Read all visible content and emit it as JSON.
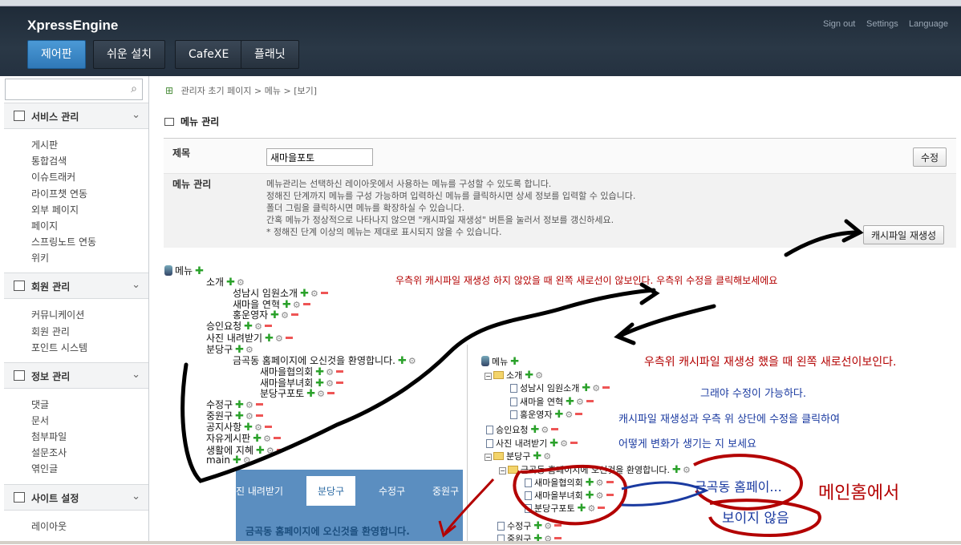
{
  "header": {
    "brand": "XpressEngine",
    "nav": [
      "제어판",
      "쉬운 설치",
      "CafeXE",
      "플래닛"
    ],
    "util": [
      "Sign out",
      "Settings",
      "Language"
    ]
  },
  "sidebar": {
    "sections": [
      {
        "title": "서비스 관리",
        "items": [
          "게시판",
          "통합검색",
          "이슈트래커",
          "라이프챗 연동",
          "외부 페이지",
          "페이지",
          "스프링노트 연동",
          "위키"
        ]
      },
      {
        "title": "회원 관리",
        "items": [
          "커뮤니케이션",
          "회원 관리",
          "포인트 시스템"
        ]
      },
      {
        "title": "정보 관리",
        "items": [
          "댓글",
          "문서",
          "첨부파일",
          "설문조사",
          "엮인글"
        ]
      },
      {
        "title": "사이트 설정",
        "items": [
          "레이아웃"
        ]
      }
    ]
  },
  "breadcrumb": {
    "p1": "관리자 초기 페이지",
    "sep1": ">",
    "p2": "메뉴",
    "sep2": ">",
    "p3": "[보기]"
  },
  "page_title": "메뉴 관리",
  "form": {
    "title_label": "제목",
    "title_value": "새마을포토",
    "edit_button": "수정",
    "manage_label": "메뉴 관리",
    "desc": [
      "메뉴관리는 선택하신 레이아웃에서 사용하는 메뉴를 구성할 수 있도록 합니다.",
      "정해진 단계까지 메뉴를 구성 가능하며 입력하신 메뉴를 클릭하시면 상세 정보를 입력할 수 있습니다.",
      "폴더 그림을 클릭하시면 메뉴를 확장하실 수 있습니다.",
      "간혹 메뉴가 정상적으로 나타나지 않으면 \"캐시파일 재생성\" 버튼을 눌러서 정보를 갱신하세요.",
      "* 정해진 단계 이상의 메뉴는 제대로 표시되지 않을 수 있습니다."
    ],
    "cache_button": "캐시파일 재생성"
  },
  "tree1": {
    "root": "메뉴",
    "nodes": [
      "소개",
      "성남시 임원소개",
      "새마을 연혁",
      "홍운영자",
      "승인요청",
      "사진 내려받기",
      "분당구",
      "금곡동 홈페이지에 오신것을 환영합니다.",
      "새마을협의회",
      "새마을부녀회",
      "분당구포토",
      "수정구",
      "중원구",
      "공지사항",
      "자유게시판",
      "생활에 지혜",
      "main"
    ]
  },
  "tree2": {
    "root": "메뉴",
    "nodes": [
      "소개",
      "성남시 임원소개",
      "새마을 연혁",
      "홍운영자",
      "승인요청",
      "사진 내려받기",
      "분당구",
      "금곡동 홈페이지에 오신것을 환영합니다.",
      "새마을협의회",
      "새마을부녀회",
      "분당구포토",
      "수정구",
      "중원구"
    ]
  },
  "site_preview": {
    "tabs": [
      "진 내려받기",
      "분당구",
      "수정구",
      "중원구"
    ],
    "welcome": "금곡동 홈페이지에 오신것을 환영합니다."
  },
  "annotations": {
    "a1": "우측위 캐시파일 재생성 하지 않았을 때 왼쪽 새로선이 않보인다. 우측위 수정을 클릭해보세에요",
    "a2": "우측위 캐시파일 재생성 했을 때 왼쪽 새로선이보인다.",
    "a3": "그래야 수정이 가능하다.",
    "a4": "캐시파일 재생성과  우측 위 상단에 수정을 클릭하여",
    "a5": "어떻게 변화가 생기는 지 보세요",
    "a6": "금곡동 홈페이...",
    "a7": "메인홈에서",
    "a8": "보이지 않음"
  },
  "colors": {
    "accent": "#2f78b7",
    "annot_red": "#b30000",
    "annot_blue": "#1a3aa0",
    "plus": "#2aa12a"
  }
}
